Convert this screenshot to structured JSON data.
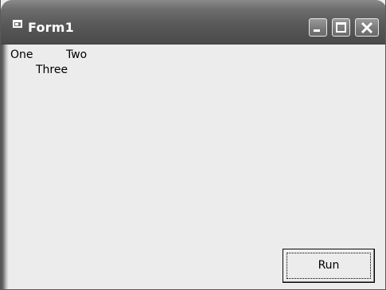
{
  "window": {
    "title": "Form1",
    "icon": "form-window-icon",
    "controls": {
      "minimize_icon": "minimize-icon",
      "maximize_icon": "maximize-icon",
      "close_icon": "close-icon"
    }
  },
  "labels": {
    "one": "One",
    "two": "Two",
    "three": "Three"
  },
  "buttons": {
    "run_label": "Run"
  },
  "colors": {
    "titlebar": "#595959",
    "client_background": "#ececec",
    "text": "#000000"
  }
}
